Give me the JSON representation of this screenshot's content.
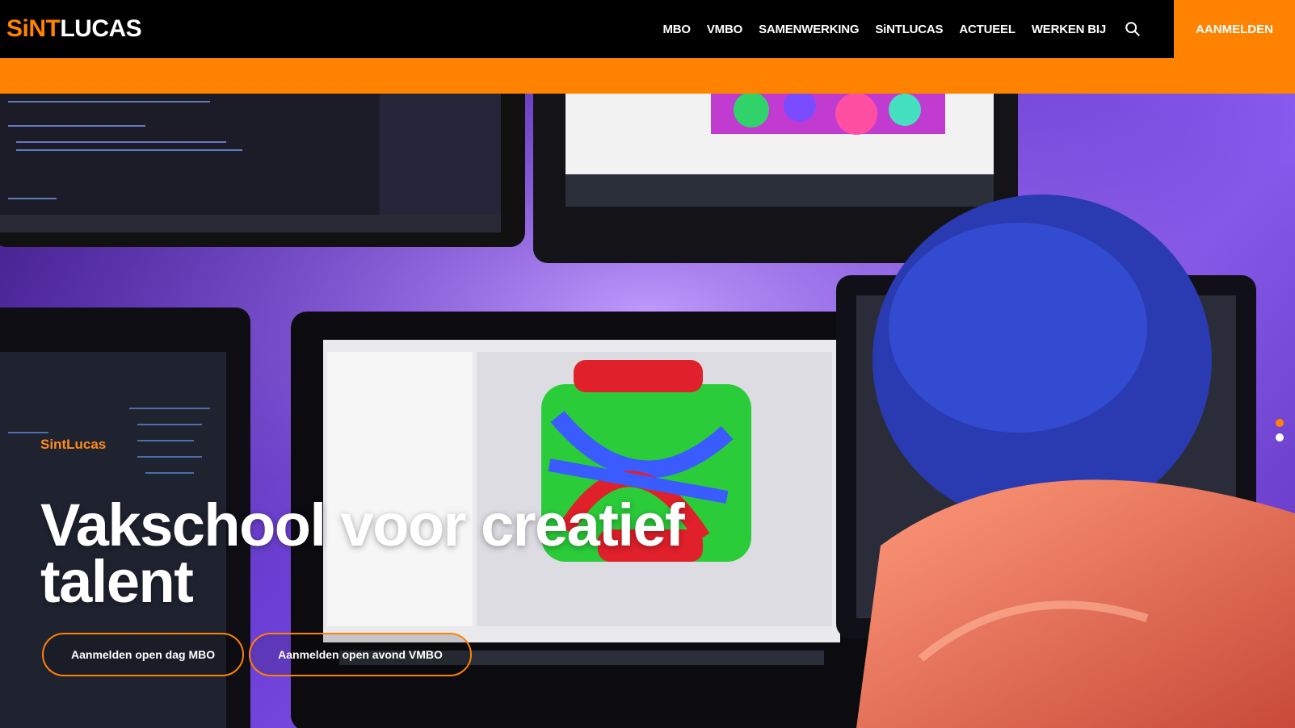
{
  "header": {
    "logo_sint": "SiNT",
    "logo_lucas": "LUCAS",
    "nav": [
      "MBO",
      "VMBO",
      "SAMENWERKING",
      "SiNTLUCAS",
      "ACTUEEL",
      "WERKEN BIJ"
    ],
    "search_icon": "search-icon",
    "signup_label": "AANMELDEN"
  },
  "hero": {
    "title": "Vakschool voor creatief talent",
    "screen_logo": "SintLucas",
    "buttons": [
      "Aanmelden open dag MBO",
      "Aanmelden open avond VMBO"
    ],
    "slides": 2,
    "active_slide": 1
  },
  "colors": {
    "brand_orange": "#ff8200",
    "header_bg": "#000000",
    "hero_purple": "#6b3fd6"
  }
}
